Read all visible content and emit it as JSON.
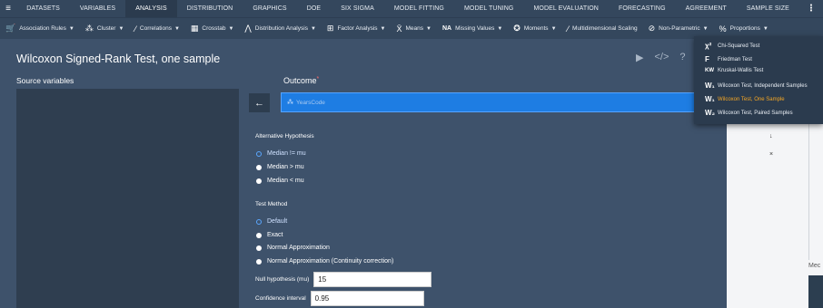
{
  "topnav": {
    "items": [
      "DATASETS",
      "VARIABLES",
      "ANALYSIS",
      "DISTRIBUTION",
      "GRAPHICS",
      "DOE",
      "SIX SIGMA",
      "MODEL FITTING",
      "MODEL TUNING",
      "MODEL EVALUATION",
      "FORECASTING",
      "AGREEMENT",
      "SAMPLE SIZE"
    ],
    "active": "ANALYSIS"
  },
  "toolbar": {
    "association_rules": "Association Rules",
    "cluster": "Cluster",
    "correlations": "Correlations",
    "crosstab": "Crosstab",
    "distribution_analysis": "Distribution Analysis",
    "factor_analysis": "Factor Analysis",
    "means": "Means",
    "missing_values": "Missing Values",
    "moments": "Moments",
    "multidimensional_scaling": "Multidimensional Scaling",
    "non_parametric": "Non-Parametric",
    "proportions": "Proportions"
  },
  "page": {
    "title": "Wilcoxon Signed-Rank Test, one sample",
    "source_variables": "Source variables",
    "outcome_label": "Outcome",
    "outcome_value": "YearsCode"
  },
  "hypothesis": {
    "label": "Alternative Hypothesis",
    "options": [
      "Median != mu",
      "Median > mu",
      "Median < mu"
    ],
    "selected": 0
  },
  "method": {
    "label": "Test Method",
    "options": [
      "Default",
      "Exact",
      "Normal Approximation",
      "Normal Approximation (Continuity correction)"
    ],
    "selected": 0
  },
  "fields": {
    "null_label": "Null hypothesis (mu)",
    "null_value": "15",
    "ci_label": "Confidence interval",
    "ci_value": "0.95"
  },
  "right_panel": {
    "med_label": "Mec"
  },
  "dropdown": {
    "items": [
      {
        "icon": "χ²",
        "label": "Chi-Squared Test"
      },
      {
        "icon": "F",
        "label": "Friedman Test"
      },
      {
        "icon": "KW",
        "label": "Kruskal-Wallis Test"
      },
      {
        "icon": "W₁",
        "label": "Wilcoxon Test, Independent Samples"
      },
      {
        "icon": "W₁",
        "label": "Wilcoxon Test, One Sample"
      },
      {
        "icon": "W₂",
        "label": "Wilcoxon Test, Paired Samples"
      }
    ],
    "active_index": 4
  },
  "colors": {
    "background": "#3e526b",
    "nav": "#34475d",
    "accent": "#1e7de3",
    "active_menu": "#f5a623"
  }
}
